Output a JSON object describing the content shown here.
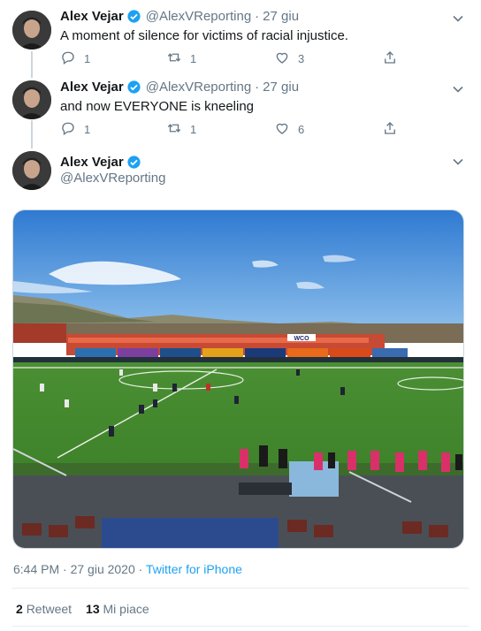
{
  "author": {
    "name": "Alex Vejar",
    "handle": "@AlexVReporting"
  },
  "tweets": [
    {
      "time": "27 giu",
      "text": "A moment of silence for victims of racial injustice.",
      "replies": "1",
      "retweets": "1",
      "likes": "3"
    },
    {
      "time": "27 giu",
      "text": "and now EVERYONE is kneeling",
      "replies": "1",
      "retweets": "1",
      "likes": "6"
    }
  ],
  "main": {
    "timestamp": "6:44 PM · 27 giu 2020 · ",
    "source": "Twitter for iPhone",
    "retweets_count": "2",
    "retweets_label": "Retweet",
    "likes_count": "13",
    "likes_label": "Mi piace",
    "photo": {
      "stadium_banners": [
        "WCO"
      ]
    }
  },
  "colors": {
    "accent": "#1da1f2",
    "secondary": "#657786",
    "pitch": "#3f8a2e",
    "sky": "#3d84d4"
  },
  "icons": [
    "verified-badge-icon",
    "chevron-down-icon",
    "reply-icon",
    "retweet-icon",
    "like-icon",
    "share-icon"
  ]
}
